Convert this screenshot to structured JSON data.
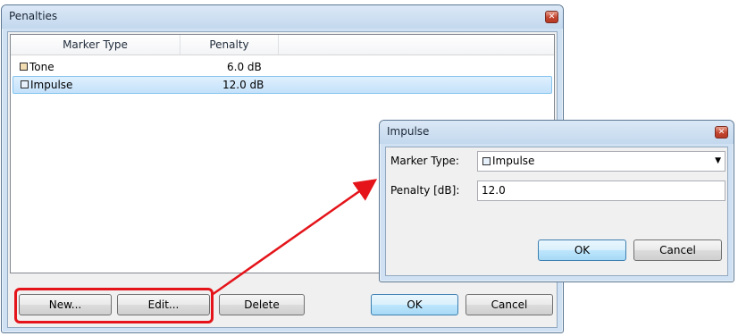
{
  "penalties_dialog": {
    "title": "Penalties",
    "columns": [
      "Marker Type",
      "Penalty"
    ],
    "rows": [
      {
        "marker_type": "Tone",
        "penalty": "6.0 dB",
        "swatch_color": "#f2dcb1",
        "selected": false
      },
      {
        "marker_type": "Impulse",
        "penalty": "12.0 dB",
        "swatch_color": "#e6f1fb",
        "selected": true
      }
    ],
    "buttons": {
      "new": "New...",
      "edit": "Edit...",
      "delete": "Delete",
      "ok": "OK",
      "cancel": "Cancel"
    }
  },
  "impulse_dialog": {
    "title": "Impulse",
    "marker_type_label": "Marker Type:",
    "marker_type_value": "Impulse",
    "penalty_label": "Penalty [dB]:",
    "penalty_value": "12.0",
    "buttons": {
      "ok": "OK",
      "cancel": "Cancel"
    }
  },
  "colors": {
    "highlight": "#e4141a",
    "arrow": "#e4141a",
    "selection": "#c4e1fa"
  },
  "icons": {
    "close": "close-icon",
    "dropdown": "chevron-down-icon"
  }
}
